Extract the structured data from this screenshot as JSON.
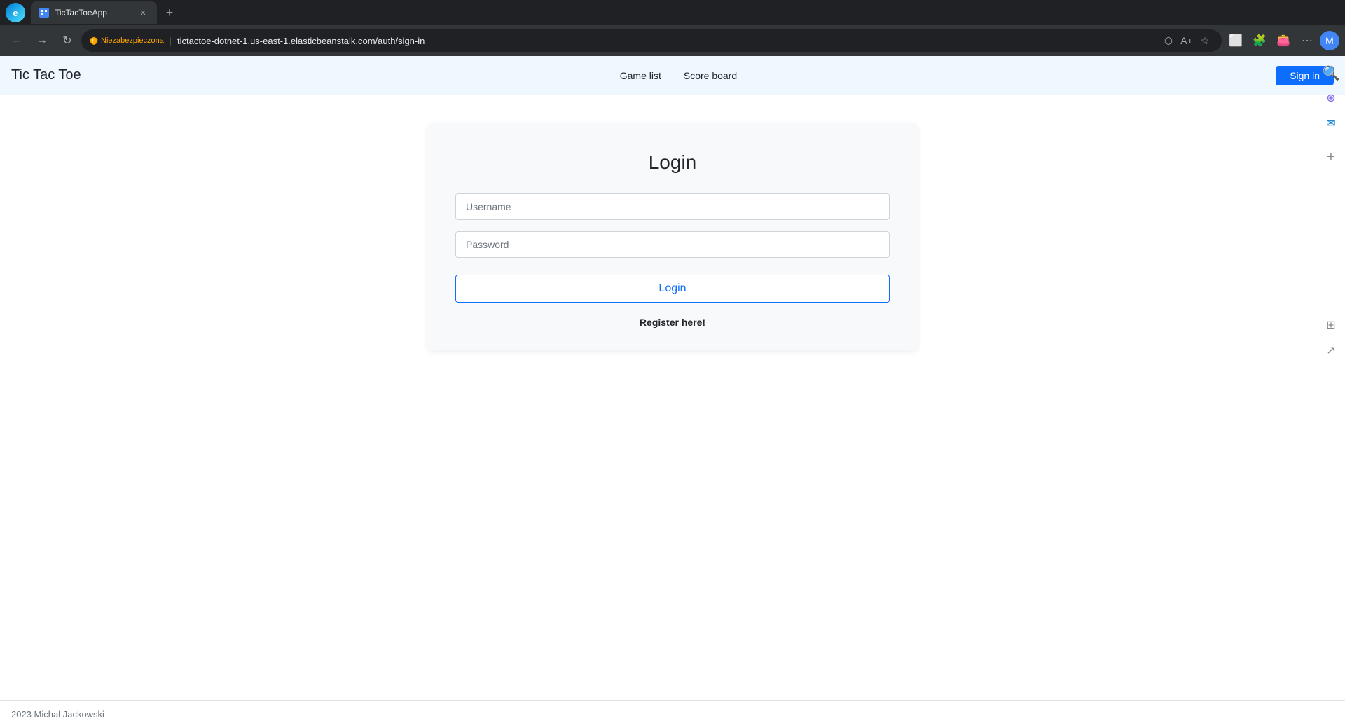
{
  "browser": {
    "tab_title": "TicTacToeApp",
    "url": "tictactoe-dotnet-1.us-east-1.elasticbeanstalk.com/auth/sign-in",
    "security_label": "Niezabezpieczona"
  },
  "navbar": {
    "brand": "Tic Tac Toe",
    "nav_links": [
      {
        "label": "Game list",
        "href": "#"
      },
      {
        "label": "Score board",
        "href": "#"
      }
    ],
    "signin_label": "Sign in"
  },
  "login_form": {
    "title": "Login",
    "username_placeholder": "Username",
    "password_placeholder": "Password",
    "login_button": "Login",
    "register_link": "Register here!"
  },
  "footer": {
    "text": "2023 Michał Jackowski"
  }
}
